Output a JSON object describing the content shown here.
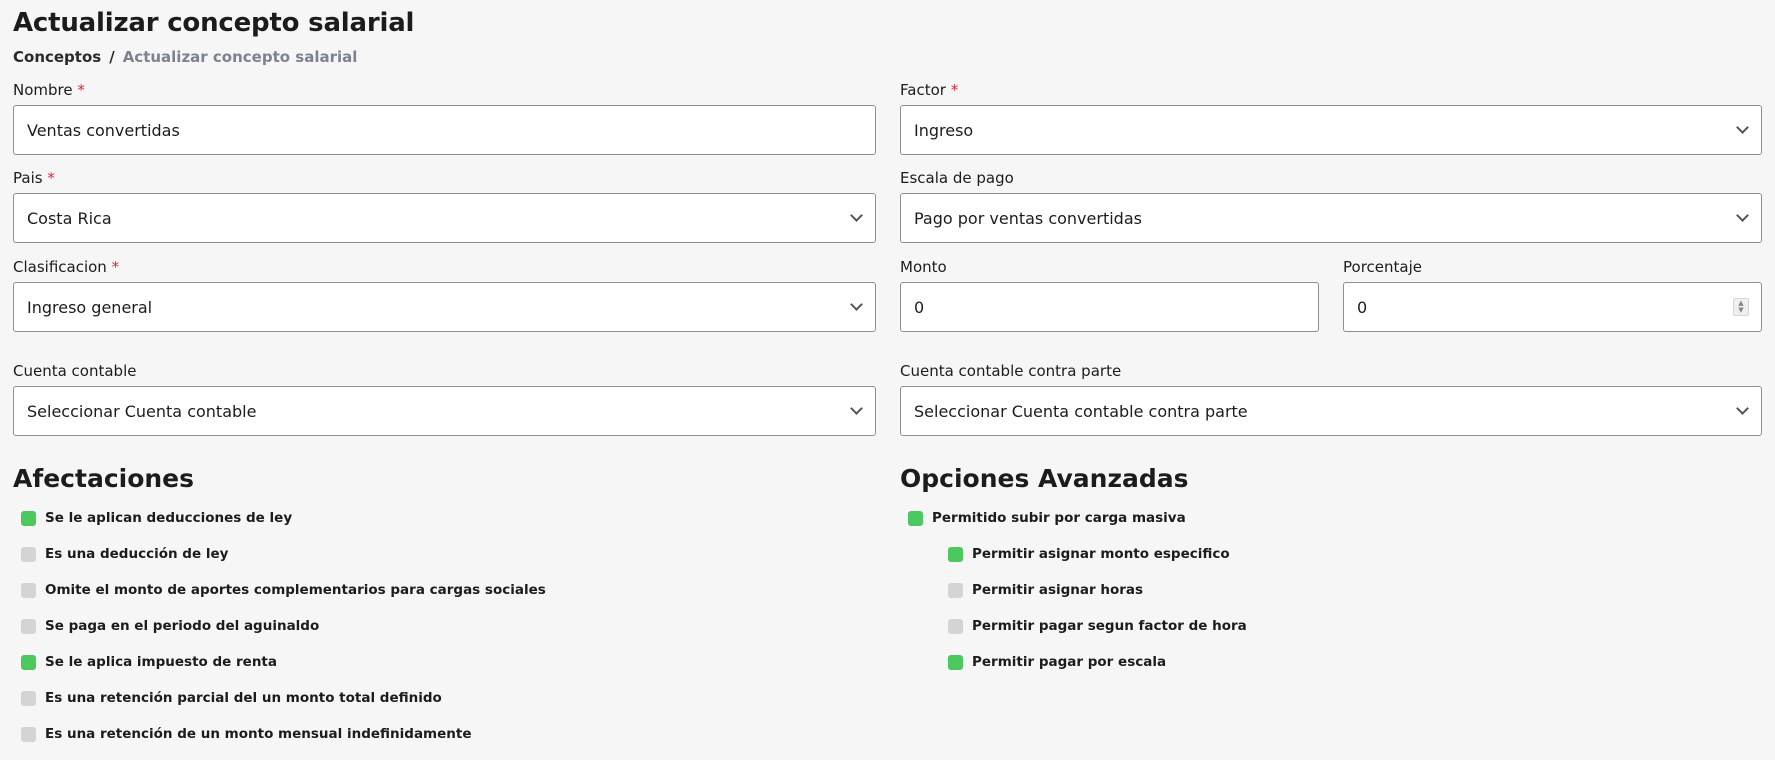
{
  "header": {
    "title": "Actualizar concepto salarial",
    "breadcrumb": {
      "parent": "Conceptos",
      "separator": "/",
      "current": "Actualizar concepto salarial"
    }
  },
  "form": {
    "nombre": {
      "label": "Nombre",
      "required_mark": "*",
      "value": "Ventas convertidas"
    },
    "factor": {
      "label": "Factor",
      "required_mark": "*",
      "value": "Ingreso"
    },
    "pais": {
      "label": "Pais",
      "required_mark": "*",
      "value": "Costa Rica"
    },
    "escala": {
      "label": "Escala de pago",
      "value": "Pago por ventas convertidas"
    },
    "clasificacion": {
      "label": "Clasificacion",
      "required_mark": "*",
      "value": "Ingreso general"
    },
    "monto": {
      "label": "Monto",
      "value": "0"
    },
    "porcentaje": {
      "label": "Porcentaje",
      "value": "0"
    },
    "cuenta": {
      "label": "Cuenta contable",
      "value": "Seleccionar Cuenta contable"
    },
    "contraparte": {
      "label": "Cuenta contable contra parte",
      "value": "Seleccionar Cuenta contable contra parte"
    }
  },
  "afectaciones": {
    "title": "Afectaciones",
    "items": [
      {
        "label": "Se le aplican deducciones de ley",
        "checked": true
      },
      {
        "label": "Es una deducción de ley",
        "checked": false
      },
      {
        "label": "Omite el monto de aportes complementarios para cargas sociales",
        "checked": false
      },
      {
        "label": "Se paga en el periodo del aguinaldo",
        "checked": false
      },
      {
        "label": "Se le aplica impuesto de renta",
        "checked": true
      },
      {
        "label": "Es una retención parcial del un monto total definido",
        "checked": false
      },
      {
        "label": "Es una retención de un monto mensual indefinidamente",
        "checked": false
      }
    ]
  },
  "avanzadas": {
    "title": "Opciones Avanzadas",
    "items": [
      {
        "label": "Permitido subir por carga masiva",
        "checked": true
      },
      {
        "label": "Permitir asignar monto especifico",
        "checked": true
      },
      {
        "label": "Permitir asignar horas",
        "checked": false
      },
      {
        "label": "Permitir pagar segun factor de hora",
        "checked": false
      },
      {
        "label": "Permitir pagar por escala",
        "checked": true
      }
    ]
  },
  "colors": {
    "accent_checked": "#4cc95e",
    "unchecked": "#d4d4d4",
    "required": "#e0243a"
  }
}
